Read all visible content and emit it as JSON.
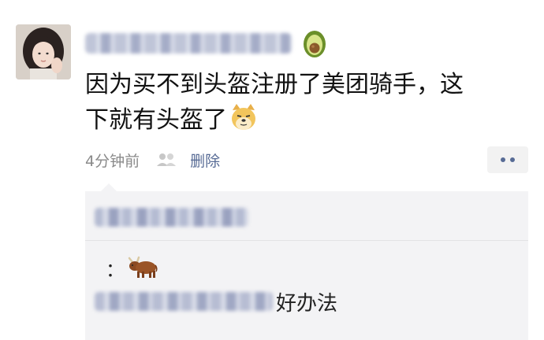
{
  "post": {
    "text_line1": "因为买不到头盔注册了美团骑手，这",
    "text_line2": "下就有头盔了"
  },
  "meta": {
    "time": "4分钟前",
    "delete_label": "删除"
  },
  "comments": {
    "first_separator": "：",
    "second_text": "好办法"
  },
  "icons": {
    "name_badge": "avocado-icon",
    "post_emoji": "doge-icon",
    "visibility": "people-icon",
    "more": "more-icon",
    "comment_emoji": "ox-icon"
  },
  "colors": {
    "link": "#576b95",
    "meta": "#8a8a8a",
    "comment_bg": "#f3f3f5"
  }
}
